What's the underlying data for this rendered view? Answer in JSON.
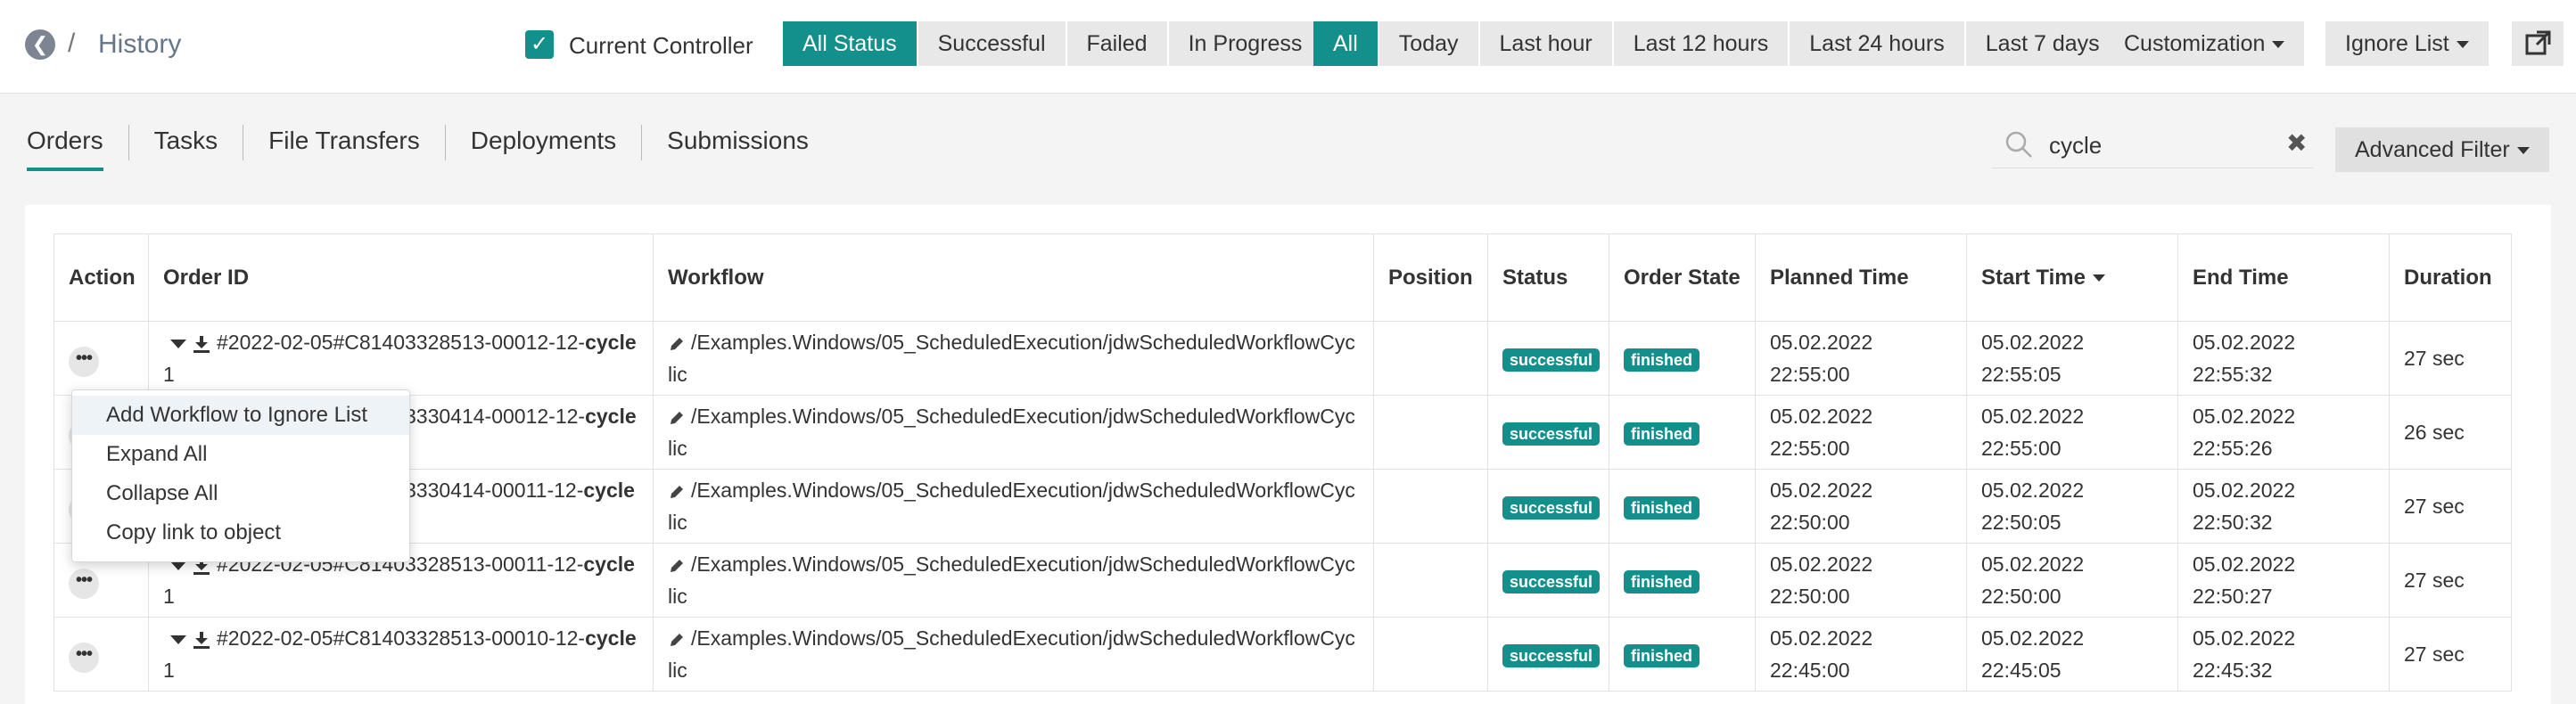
{
  "header": {
    "title": "History",
    "separator": "/",
    "current_controller_label": "Current Controller",
    "status_filters": [
      "All Status",
      "Successful",
      "Failed",
      "In Progress"
    ],
    "active_status": "All Status",
    "time_filters": [
      "All",
      "Today",
      "Last hour",
      "Last 12 hours",
      "Last 24 hours",
      "Last 7 days"
    ],
    "active_time": "All",
    "customization_label": "Customization",
    "ignore_list_label": "Ignore List"
  },
  "tabs": [
    "Orders",
    "Tasks",
    "File Transfers",
    "Deployments",
    "Submissions"
  ],
  "active_tab": "Orders",
  "search": {
    "value": "cycle",
    "clear": "✖"
  },
  "advanced_filter_label": "Advanced Filter",
  "table": {
    "columns": [
      "Action",
      "Order ID",
      "Workflow",
      "Position",
      "Status",
      "Order State",
      "Planned Time",
      "Start Time",
      "End Time",
      "Duration"
    ],
    "rows": [
      {
        "id_pre": "#2022-02-05#C81403328513-00012-12-",
        "id_bold": "cycle",
        "id_post": "1",
        "workflow": "/Examples.Windows/05_ScheduledExecution/jdwScheduledWorkflowCyclic",
        "status": "successful",
        "state": "finished",
        "planned_date": "05.02.2022",
        "planned_time": "22:55:00",
        "start_date": "05.02.2022",
        "start_time": "22:55:05",
        "end_date": "05.02.2022",
        "end_time": "22:55:32",
        "duration": "27 sec"
      },
      {
        "id_pre": "#2022-02-05#C81403330414-00012-12-",
        "id_bold": "cycle",
        "id_post": "1",
        "workflow": "/Examples.Windows/05_ScheduledExecution/jdwScheduledWorkflowCyclic",
        "status": "successful",
        "state": "finished",
        "planned_date": "05.02.2022",
        "planned_time": "22:55:00",
        "start_date": "05.02.2022",
        "start_time": "22:55:00",
        "end_date": "05.02.2022",
        "end_time": "22:55:26",
        "duration": "26 sec"
      },
      {
        "id_pre": "#2022-02-05#C81403330414-00011-12-",
        "id_bold": "cycle",
        "id_post": "1",
        "workflow": "/Examples.Windows/05_ScheduledExecution/jdwScheduledWorkflowCyclic",
        "status": "successful",
        "state": "finished",
        "planned_date": "05.02.2022",
        "planned_time": "22:50:00",
        "start_date": "05.02.2022",
        "start_time": "22:50:05",
        "end_date": "05.02.2022",
        "end_time": "22:50:32",
        "duration": "27 sec"
      },
      {
        "id_pre": "#2022-02-05#C81403328513-00011-12-",
        "id_bold": "cycle",
        "id_post": "1",
        "workflow": "/Examples.Windows/05_ScheduledExecution/jdwScheduledWorkflowCyclic",
        "status": "successful",
        "state": "finished",
        "planned_date": "05.02.2022",
        "planned_time": "22:50:00",
        "start_date": "05.02.2022",
        "start_time": "22:50:00",
        "end_date": "05.02.2022",
        "end_time": "22:50:27",
        "duration": "27 sec"
      },
      {
        "id_pre": "#2022-02-05#C81403328513-00010-12-",
        "id_bold": "cycle",
        "id_post": "1",
        "workflow": "/Examples.Windows/05_ScheduledExecution/jdwScheduledWorkflowCyclic",
        "status": "successful",
        "state": "finished",
        "planned_date": "05.02.2022",
        "planned_time": "22:45:00",
        "start_date": "05.02.2022",
        "start_time": "22:45:05",
        "end_date": "05.02.2022",
        "end_time": "22:45:32",
        "duration": "27 sec"
      }
    ]
  },
  "context_menu": {
    "items": [
      "Add Workflow to Ignore List",
      "Expand All",
      "Collapse All",
      "Copy link to object"
    ]
  },
  "colors": {
    "accent": "#138f8c",
    "button_bg": "#e8e8e8"
  }
}
